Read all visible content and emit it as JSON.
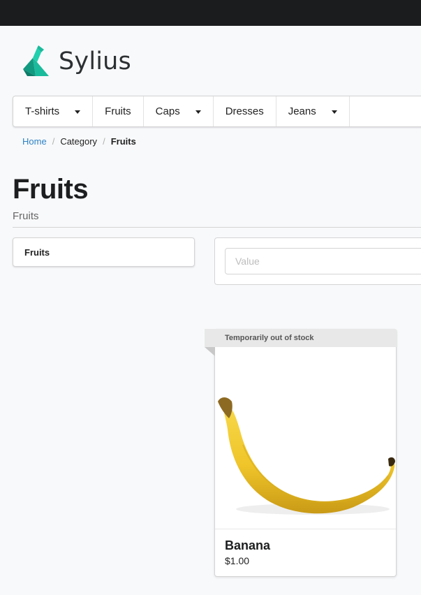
{
  "brand": {
    "name": "Sylius",
    "accent": "#1abb9c"
  },
  "menu": {
    "items": [
      {
        "label": "T-shirts",
        "dropdown": true
      },
      {
        "label": "Fruits",
        "dropdown": false
      },
      {
        "label": "Caps",
        "dropdown": true
      },
      {
        "label": "Dresses",
        "dropdown": false
      },
      {
        "label": "Jeans",
        "dropdown": true
      }
    ]
  },
  "breadcrumb": {
    "home": "Home",
    "category": "Category",
    "current": "Fruits"
  },
  "page": {
    "title": "Fruits",
    "subtitle": "Fruits"
  },
  "sidebar": {
    "items": [
      {
        "label": "Fruits"
      }
    ]
  },
  "filter": {
    "placeholder": "Value",
    "value": ""
  },
  "products": [
    {
      "ribbon": "Temporarily out of stock",
      "name": "Banana",
      "price": "$1.00",
      "image_icon": "banana-image"
    }
  ]
}
